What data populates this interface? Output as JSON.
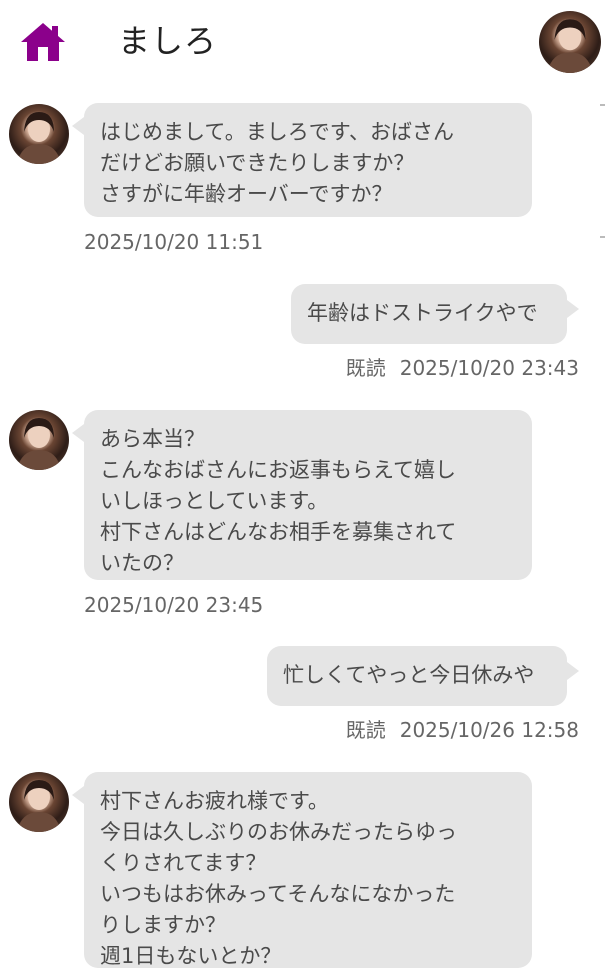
{
  "header": {
    "title": "ましろ",
    "home_icon": "home-icon",
    "accent_color": "#8b008b"
  },
  "messages": [
    {
      "side": "incoming",
      "text": "はじめまして。ましろです、おばさん\nだけどお願いできたりしますか？\nさすがに年齢オーバーですか？",
      "timestamp": "2025/10/20 11:51"
    },
    {
      "side": "outgoing",
      "text": "年齢はドストライクやで",
      "read_label": "既読",
      "timestamp": "2025/10/20 23:43"
    },
    {
      "side": "incoming",
      "text": "あら本当？\nこんなおばさんにお返事もらえて嬉し\nいしほっとしています。\n村下さんはどんなお相手を募集されて\nいたの？",
      "timestamp": "2025/10/20 23:45"
    },
    {
      "side": "outgoing",
      "text": "忙しくてやっと今日休みや",
      "read_label": "既読",
      "timestamp": "2025/10/26 12:58"
    },
    {
      "side": "incoming",
      "text": "村下さんお疲れ様です。\n今日は久しぶりのお休みだったらゆっ\nくりされてます？\nいつもはお休みってそんなになかった\nりしますか？\n週1日もないとか？",
      "timestamp": ""
    }
  ]
}
